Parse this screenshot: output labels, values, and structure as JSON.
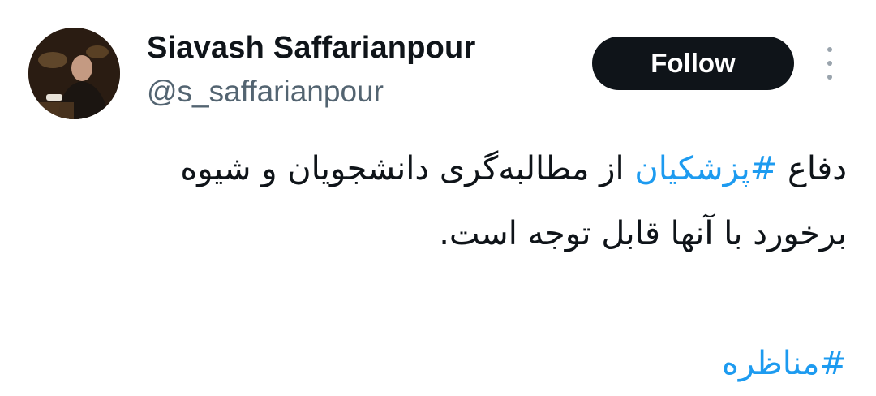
{
  "author": {
    "name": "Siavash Saffarianpour",
    "handle": "@s_saffarianpour",
    "avatar_icon": "profile-photo"
  },
  "actions": {
    "follow_label": "Follow",
    "more_icon": "more-vertical-icon"
  },
  "tweet": {
    "line1_prefix": "دفاع ",
    "line1_hashtag": "#پزشکیان",
    "line1_suffix": " از مطالبه‌گری دانشجویان و شیوه",
    "line2": "برخورد با آنها قابل توجه  است.",
    "hashtag2": "#مناظره"
  },
  "colors": {
    "text": "#0f1419",
    "secondary": "#536471",
    "link": "#1d9bf0",
    "button": "#0f1419"
  }
}
